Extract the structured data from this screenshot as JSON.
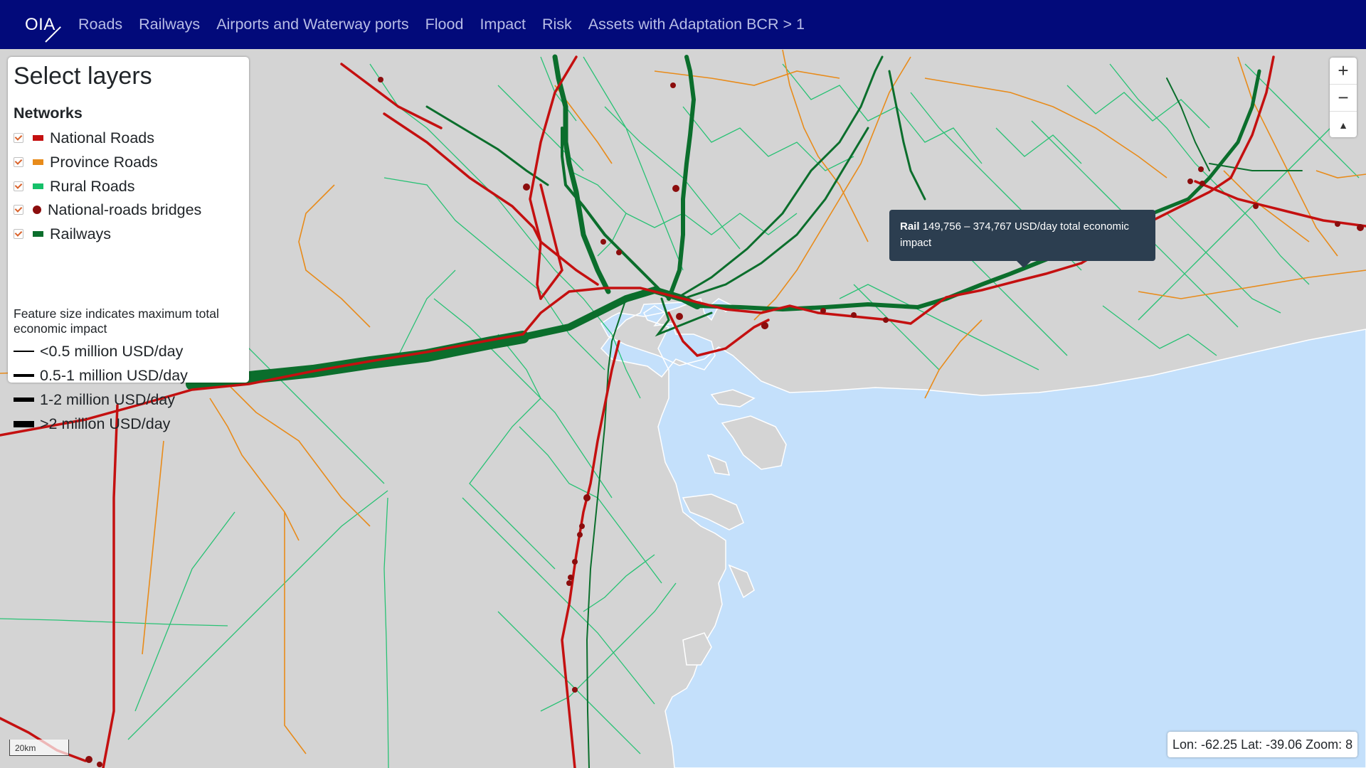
{
  "brand": {
    "label": "OIA"
  },
  "nav": {
    "items": [
      "Roads",
      "Railways",
      "Airports and Waterway ports",
      "Flood",
      "Impact",
      "Risk",
      "Assets with Adaptation BCR > 1"
    ]
  },
  "panel": {
    "title": "Select layers",
    "section": "Networks",
    "layers": [
      {
        "label": "National Roads",
        "color": "#c41010",
        "kind": "line",
        "checked": true
      },
      {
        "label": "Province Roads",
        "color": "#e88b1a",
        "kind": "line",
        "checked": true
      },
      {
        "label": "Rural Roads",
        "color": "#16c06a",
        "kind": "line",
        "checked": true
      },
      {
        "label": "National-roads bridges",
        "color": "#8b0d0d",
        "kind": "dot",
        "checked": true
      },
      {
        "label": "Railways",
        "color": "#0b6e2c",
        "kind": "line",
        "checked": true
      }
    ],
    "note": "Feature size indicates maximum total economic impact",
    "sizes": [
      {
        "label": "<0.5 million USD/day"
      },
      {
        "label": "0.5-1 million USD/day"
      },
      {
        "label": "1-2 million USD/day"
      },
      {
        "label": ">2 million USD/day"
      }
    ]
  },
  "zoom": {
    "in": "+",
    "out": "−",
    "reset": "▲"
  },
  "tooltip": {
    "title": "Rail",
    "text": "149,756 – 374,767 USD/day total economic impact"
  },
  "coords": {
    "text": "Lon: -62.25 Lat: -39.06 Zoom: 8"
  },
  "scale": {
    "label": "20km"
  },
  "colors": {
    "navbar": "#020a7a",
    "land": "#d4d4d4",
    "water": "#c4e0fb",
    "national": "#c41010",
    "province": "#e88b1a",
    "rural": "#16c06a",
    "rail": "#0b6e2c",
    "bridge": "#8b0d0d"
  }
}
